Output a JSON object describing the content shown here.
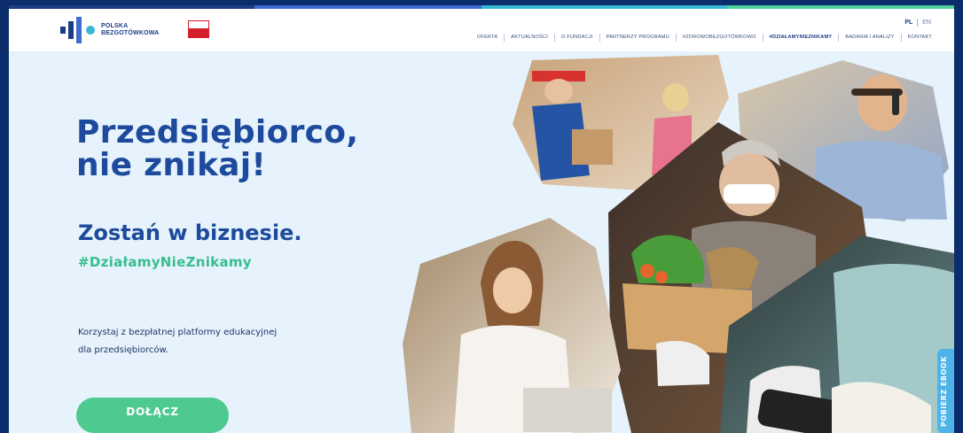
{
  "brand": {
    "logo_line1": "POLSKA",
    "logo_line2": "BEZGOTÓWKOWA",
    "colors": {
      "navy": "#1a3d86",
      "blue": "#1d4a9c",
      "green": "#4ec98f",
      "teal": "#36b7d6",
      "bg": "#e6f3fc"
    }
  },
  "header": {
    "lang_active": "PL",
    "lang_other": "EN",
    "nav": [
      {
        "label": "OFERTA",
        "active": false
      },
      {
        "label": "AKTUALNOŚCI",
        "active": false
      },
      {
        "label": "O FUNDACJI",
        "active": false
      },
      {
        "label": "PARTNERZY PROGRAMU",
        "active": false
      },
      {
        "label": "#ZDROWOBEZGOTÓWKOWO",
        "active": false
      },
      {
        "label": "#DZIAŁAMYNIEZNIKAMY",
        "active": true
      },
      {
        "label": "BADANIA I ANALIZY",
        "active": false
      },
      {
        "label": "KONTAKT",
        "active": false
      }
    ]
  },
  "hero": {
    "title_line1": "Przedsiębiorco,",
    "title_line2": "nie znikaj!",
    "subtitle": "Zostań w biznesie.",
    "hashtag": "#DziałamyNieZnikamy",
    "desc_line1": "Korzystaj z bezpłatnej platformy edukacyjnej",
    "desc_line2": "dla przedsiębiorców.",
    "cta_label": "DOŁĄCZ"
  },
  "side_tab": {
    "label": "POBIERZ EBOOK"
  },
  "collage_photos": [
    "delivery-photo",
    "phone-call-photo",
    "vegetables-crate-photo",
    "smiling-woman-photo",
    "card-terminal-photo"
  ]
}
